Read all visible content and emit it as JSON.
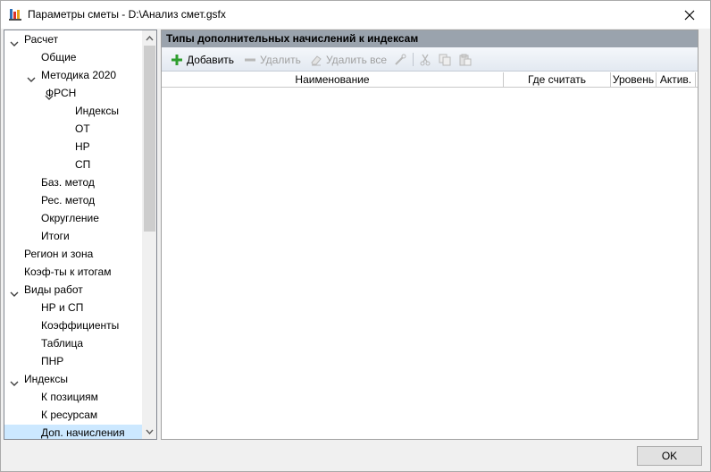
{
  "window": {
    "title": "Параметры сметы - D:\\Анализ смет.gsfx"
  },
  "tree": {
    "items": [
      {
        "label": "Расчет",
        "expanded": true
      },
      {
        "label": "Общие"
      },
      {
        "label": "Методика 2020",
        "expanded": true
      },
      {
        "label": "ФРСН",
        "expanded": true
      },
      {
        "label": "Индексы"
      },
      {
        "label": "ОТ"
      },
      {
        "label": "НР"
      },
      {
        "label": "СП"
      },
      {
        "label": "Баз. метод"
      },
      {
        "label": "Рес. метод"
      },
      {
        "label": "Округление"
      },
      {
        "label": "Итоги"
      },
      {
        "label": "Регион и зона"
      },
      {
        "label": "Коэф-ты к итогам"
      },
      {
        "label": "Виды работ",
        "expanded": true
      },
      {
        "label": "НР и СП"
      },
      {
        "label": "Коэффициенты"
      },
      {
        "label": "Таблица"
      },
      {
        "label": "ПНР"
      },
      {
        "label": "Индексы",
        "expanded": true
      },
      {
        "label": "К позициям"
      },
      {
        "label": "К ресурсам"
      },
      {
        "label": "Доп. начисления",
        "selected": true
      }
    ]
  },
  "panel": {
    "header": "Типы дополнительных начислений к индексам"
  },
  "toolbar": {
    "add_label": "Добавить",
    "delete_label": "Удалить",
    "delete_all_label": "Удалить все"
  },
  "grid": {
    "columns": [
      "Наименование",
      "Где считать",
      "Уровень",
      "Актив."
    ]
  },
  "buttons": {
    "ok": "OK"
  },
  "colors": {
    "selection": "#cce8ff",
    "header": "#9aa3ad",
    "add_icon": "#2e9e2e"
  }
}
